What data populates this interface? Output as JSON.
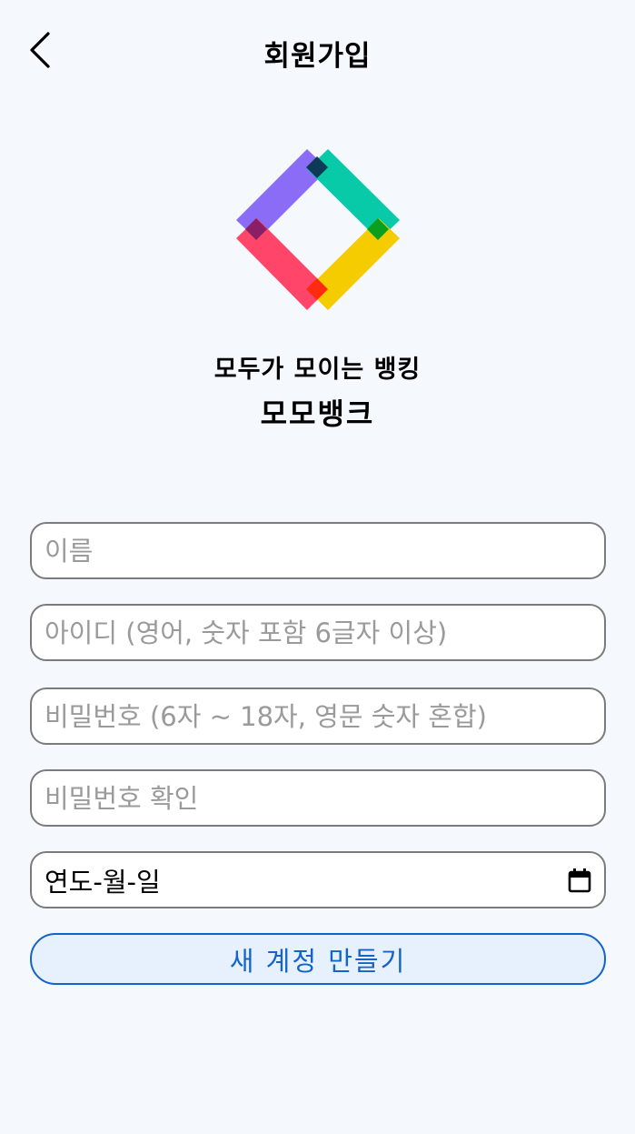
{
  "header": {
    "title": "회원가입"
  },
  "icons": {
    "back": "chevron-left-icon",
    "logo": "diamond-logo-icon",
    "calendar": "calendar-icon"
  },
  "branding": {
    "tagline": "모두가 모이는 뱅킹",
    "name": "모모뱅크",
    "colors": {
      "purple": "#8a6cf7",
      "green": "#08c9a8",
      "red": "#ff4569",
      "yellow": "#f5cc00",
      "button_blue": "#1463c8"
    }
  },
  "form": {
    "name_placeholder": "이름",
    "id_placeholder": "아이디 (영어, 숫자 포함 6글자 이상)",
    "password_placeholder": "비밀번호 (6자 ~ 18자, 영문 숫자 혼합)",
    "password_confirm_placeholder": "비밀번호 확인",
    "birthdate_value": "연도-월-일",
    "submit_label": "새 계정 만들기"
  }
}
